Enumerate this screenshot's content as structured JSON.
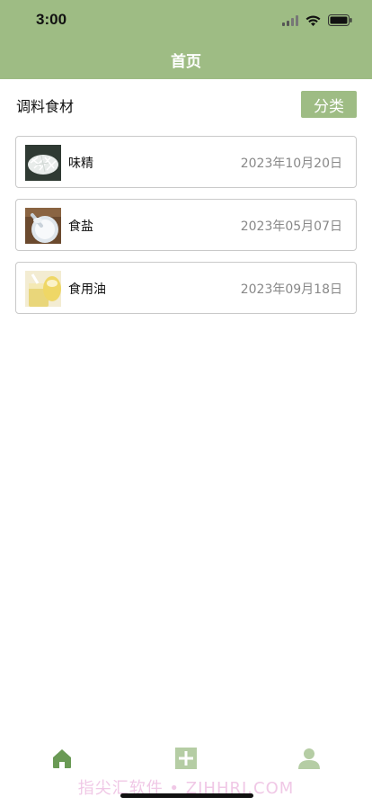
{
  "status_bar": {
    "time": "3:00"
  },
  "nav": {
    "title": "首页"
  },
  "section": {
    "title": "调料食材",
    "category_button": "分类"
  },
  "items": [
    {
      "name": "味精",
      "date": "2023年10月20日",
      "thumb_icon": "msg-crystals-photo"
    },
    {
      "name": "食盐",
      "date": "2023年05月07日",
      "thumb_icon": "salt-bowl-photo"
    },
    {
      "name": "食用油",
      "date": "2023年09月18日",
      "thumb_icon": "cooking-oil-photo"
    }
  ],
  "tab_bar": {
    "items": [
      {
        "icon": "home-icon",
        "active": true
      },
      {
        "icon": "add-icon",
        "active": false
      },
      {
        "icon": "user-icon",
        "active": false
      }
    ],
    "active_color": "#6a9a55",
    "inactive_color": "#b5cda4"
  },
  "watermark": "指尖汇软件 • ZJHHRJ.COM",
  "colors": {
    "header": "#9ebc84",
    "accent": "#9ebc84"
  }
}
